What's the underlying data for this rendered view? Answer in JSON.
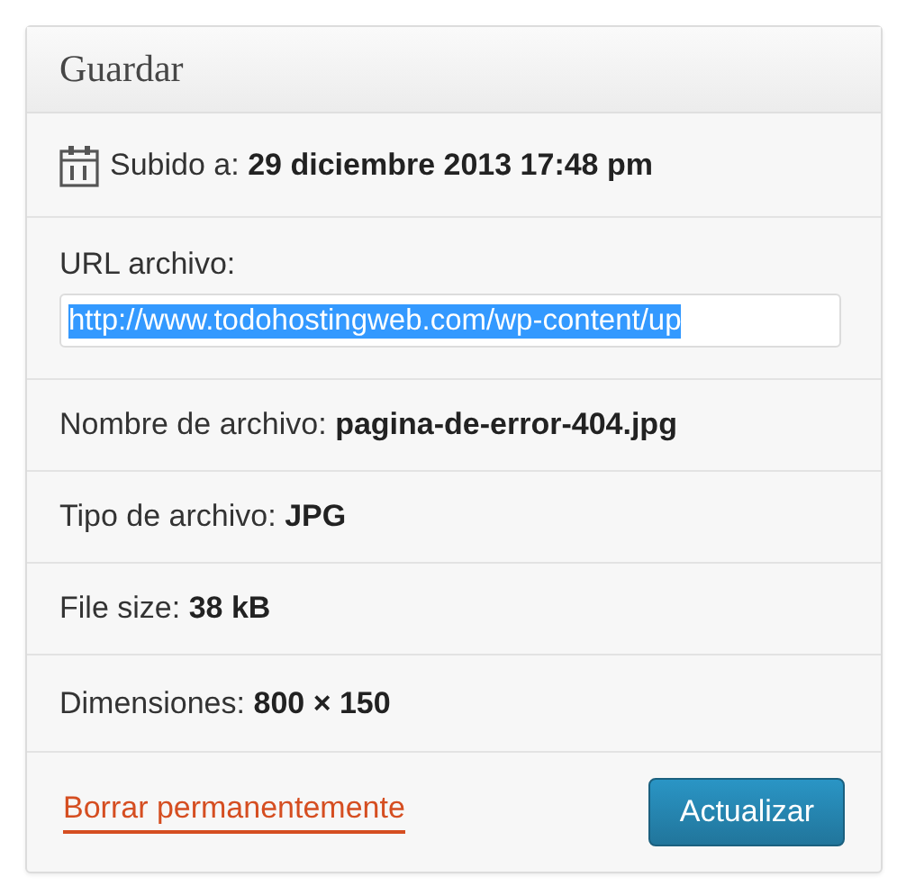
{
  "panel": {
    "title": "Guardar"
  },
  "uploaded": {
    "label": "Subido a:",
    "value": "29 diciembre 2013 17:48 pm"
  },
  "url": {
    "label": "URL archivo:",
    "value": "http://www.todohostingweb.com/wp-content/up",
    "selected": true
  },
  "details": [
    {
      "label": "Nombre de archivo:",
      "value": "pagina-de-error-404.jpg"
    },
    {
      "label": "Tipo de archivo:",
      "value": "JPG"
    },
    {
      "label": "File size:",
      "value": "38 kB"
    },
    {
      "label": "Dimensiones:",
      "value": "800 × 150"
    }
  ],
  "delete_link": "Borrar permanentemente",
  "update_button": "Actualizar"
}
